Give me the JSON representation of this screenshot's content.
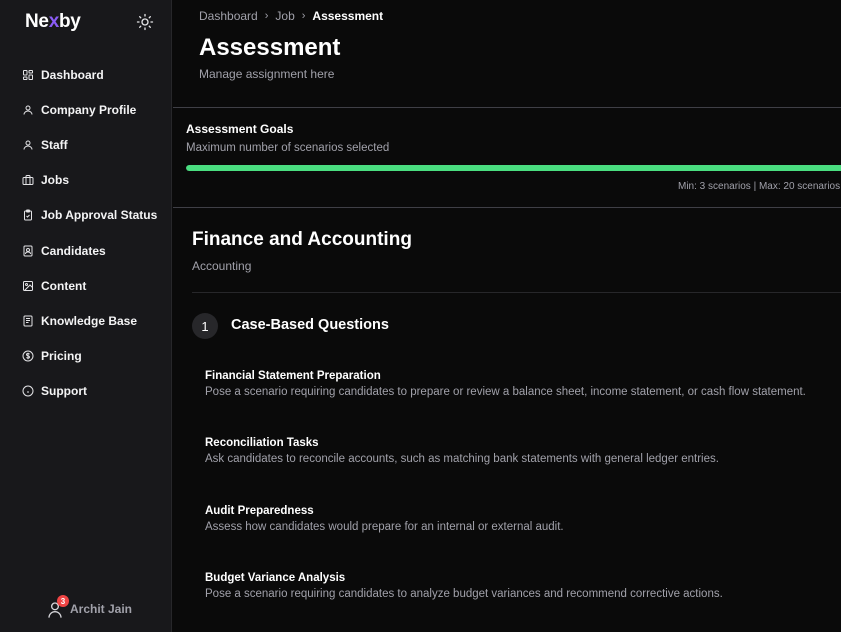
{
  "app": {
    "logo_prefix": "Ne",
    "logo_x": "x",
    "logo_suffix": "by"
  },
  "colors": {
    "background": "#0a0a0a",
    "sidebar": "#18181b",
    "accent": "#8b5cf6",
    "progress": "#4ade80",
    "badge": "#ef4444"
  },
  "sidebar": {
    "theme_icon": "sun-icon",
    "items": [
      {
        "label": "Dashboard",
        "icon": "dashboard-icon"
      },
      {
        "label": "Company Profile",
        "icon": "user-icon"
      },
      {
        "label": "Staff",
        "icon": "user-icon"
      },
      {
        "label": "Jobs",
        "icon": "briefcase-icon"
      },
      {
        "label": "Job Approval Status",
        "icon": "clipboard-check-icon"
      },
      {
        "label": "Candidates",
        "icon": "contact-icon"
      },
      {
        "label": "Content",
        "icon": "image-icon"
      },
      {
        "label": "Knowledge Base",
        "icon": "book-icon"
      },
      {
        "label": "Pricing",
        "icon": "dollar-icon"
      },
      {
        "label": "Support",
        "icon": "info-icon"
      }
    ],
    "user": {
      "name": "Archit Jain",
      "notification_count": "3"
    }
  },
  "breadcrumb": {
    "items": [
      "Dashboard",
      "Job"
    ],
    "current": "Assessment"
  },
  "header": {
    "title": "Assessment",
    "subtitle": "Manage assignment here"
  },
  "goals": {
    "title": "Assessment Goals",
    "subtitle": "Maximum number of scenarios selected",
    "progress_percent": 100,
    "limits": "Min: 3 scenarios | Max: 20 scenarios"
  },
  "section": {
    "title": "Finance and Accounting",
    "subtitle": "Accounting"
  },
  "step": {
    "number": "1",
    "title": "Case-Based Questions"
  },
  "questions": [
    {
      "title": "Financial Statement Preparation",
      "description": "Pose a scenario requiring candidates to prepare or review a balance sheet, income statement, or cash flow statement."
    },
    {
      "title": "Reconciliation Tasks",
      "description": "Ask candidates to reconcile accounts, such as matching bank statements with general ledger entries."
    },
    {
      "title": "Audit Preparedness",
      "description": "Assess how candidates would prepare for an internal or external audit."
    },
    {
      "title": "Budget Variance Analysis",
      "description": "Pose a scenario requiring candidates to analyze budget variances and recommend corrective actions."
    }
  ]
}
